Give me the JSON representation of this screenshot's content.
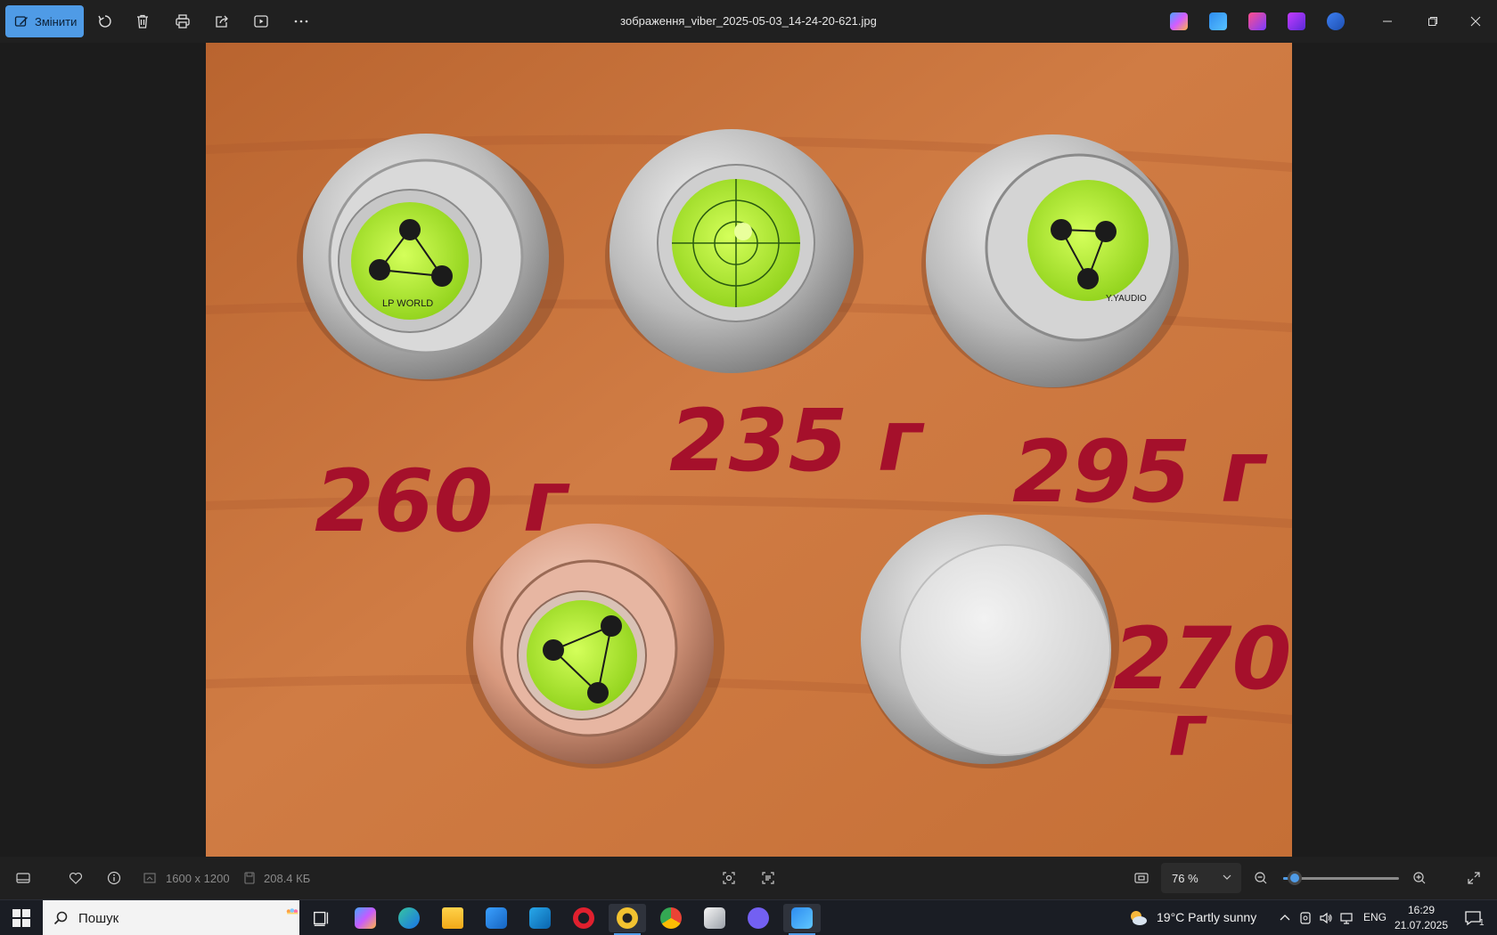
{
  "titlebar": {
    "edit_label": "Змінити",
    "filename": "зображення_viber_2025-05-03_14-24-20-621.jpg",
    "icons": [
      "rotate-icon",
      "delete-icon",
      "print-icon",
      "share-icon",
      "slideshow-icon",
      "more-icon"
    ]
  },
  "photo": {
    "labels": {
      "w1": "260 г",
      "w2": "235 г",
      "w3": "295 г",
      "w4_num": "270",
      "w4_unit": "г"
    },
    "brand": "LP WORLD",
    "brand_alt": "Y.YAUDIO",
    "colors": {
      "table": "#c9723d",
      "ink": "#a5102b",
      "bubble": "#a9ef2a",
      "chrome": "#d9d9d9",
      "copper": "#e6a98f"
    }
  },
  "statusbar": {
    "dimensions": "1600 x 1200",
    "filesize": "208.4 КБ",
    "zoom": "76 %",
    "zoom_fraction": 0.1
  },
  "taskbar": {
    "search_placeholder": "Пошук",
    "weather": "19°C  Partly sunny",
    "lang": "ENG",
    "time": "16:29",
    "date": "21.07.2025",
    "notifications": "1"
  }
}
